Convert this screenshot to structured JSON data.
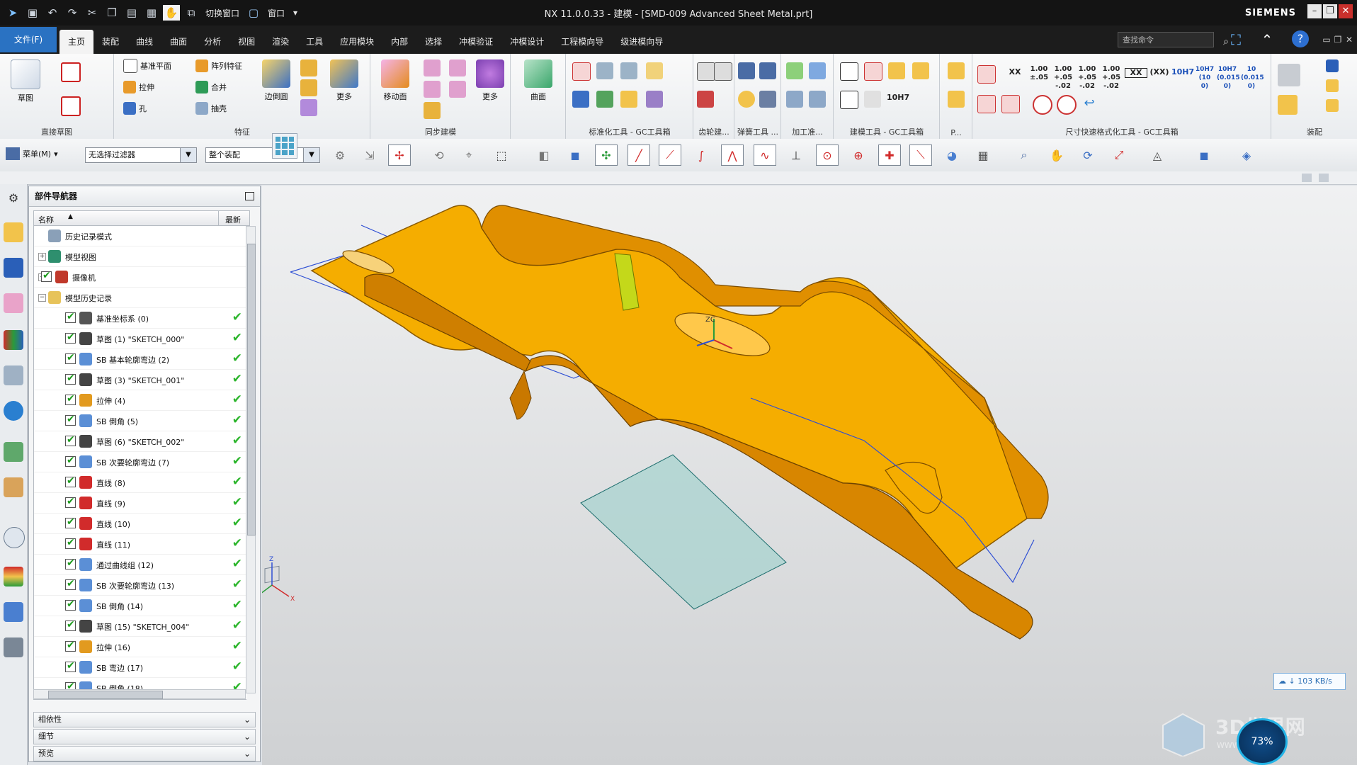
{
  "window": {
    "title": "NX 11.0.0.33 - 建模 - [SMD-009 Advanced Sheet Metal.prt]",
    "brand": "SIEMENS"
  },
  "quick_access": {
    "switch_window": "切换窗口",
    "window": "窗口"
  },
  "menu": {
    "file": "文件(F)",
    "tabs": [
      "主页",
      "装配",
      "曲线",
      "曲面",
      "分析",
      "视图",
      "渲染",
      "工具",
      "应用模块",
      "内部",
      "选择",
      "冲模验证",
      "冲模设计",
      "工程模向导",
      "级进模向导"
    ],
    "search_placeholder": "查找命令"
  },
  "ribbon": {
    "direct_sketch": {
      "sketch": "草图",
      "label": "直接草图"
    },
    "feature": {
      "datum_plane": "基准平面",
      "pattern": "阵列特征",
      "extrude": "拉伸",
      "unite": "合并",
      "hole": "孔",
      "shell": "抽壳",
      "edge_blend": "边倒圆",
      "more": "更多",
      "label": "特征"
    },
    "sync": {
      "move_face": "移动面",
      "more": "更多",
      "label": "同步建模"
    },
    "surface": {
      "label": "曲面"
    },
    "groups": [
      "标准化工具 - GC工具箱",
      "齿轮建...",
      "弹簧工具 ...",
      "加工准...",
      "建模工具 - GC工具箱",
      "P...",
      "尺寸快速格式化工具 - GC工具箱",
      "装配"
    ],
    "dim_tokens": [
      "XX",
      "1.00 ±.05",
      "1.00 +.05 -.02",
      "1.00 +.05 -.02",
      "1.00 +.05 -.02",
      "XX",
      "(XX)",
      "10H7",
      "10H7 (10 0)",
      "10H7 (0.015 0)",
      "10 (0.015 0)"
    ],
    "tool_10h7": "10H7"
  },
  "selection_bar": {
    "menu": "菜单(M)",
    "filter": "无选择过滤器",
    "scope": "整个装配"
  },
  "navigator": {
    "title": "部件导航器",
    "col_name": "名称",
    "col_latest": "最新",
    "rows": [
      {
        "label": "历史记录模式",
        "level": 0,
        "exp": "",
        "check": false,
        "ok": false,
        "icon": "clock-icon",
        "color": "#8aa0b8"
      },
      {
        "label": "模型视图",
        "level": 0,
        "exp": "+",
        "check": false,
        "ok": false,
        "icon": "cube-views-icon",
        "color": "#2e8f6e"
      },
      {
        "label": "摄像机",
        "level": 0,
        "exp": "+",
        "check": true,
        "ok": false,
        "icon": "camera-icon",
        "color": "#c0392b"
      },
      {
        "label": "模型历史记录",
        "level": 0,
        "exp": "−",
        "check": false,
        "ok": false,
        "icon": "folder-icon",
        "color": "#e7c35a"
      },
      {
        "label": "基准坐标系 (0)",
        "level": 1,
        "exp": "",
        "check": true,
        "ok": true,
        "icon": "csys-icon",
        "color": "#555555"
      },
      {
        "label": "草图 (1) \"SKETCH_000\"",
        "level": 1,
        "exp": "",
        "check": true,
        "ok": true,
        "icon": "sketch-icon",
        "color": "#444444"
      },
      {
        "label": "SB 基本轮廓弯边 (2)",
        "level": 1,
        "exp": "",
        "check": true,
        "ok": true,
        "icon": "flange-icon",
        "color": "#5b8fd6"
      },
      {
        "label": "草图 (3) \"SKETCH_001\"",
        "level": 1,
        "exp": "",
        "check": true,
        "ok": true,
        "icon": "sketch-icon",
        "color": "#444444"
      },
      {
        "label": "拉伸 (4)",
        "level": 1,
        "exp": "",
        "check": true,
        "ok": true,
        "icon": "extrude-icon",
        "color": "#e29a1f"
      },
      {
        "label": "SB 倒角 (5)",
        "level": 1,
        "exp": "",
        "check": true,
        "ok": true,
        "icon": "chamfer-icon",
        "color": "#5b8fd6"
      },
      {
        "label": "草图 (6) \"SKETCH_002\"",
        "level": 1,
        "exp": "",
        "check": true,
        "ok": true,
        "icon": "sketch-icon",
        "color": "#444444"
      },
      {
        "label": "SB 次要轮廓弯边 (7)",
        "level": 1,
        "exp": "",
        "check": true,
        "ok": true,
        "icon": "flange-icon",
        "color": "#5b8fd6"
      },
      {
        "label": "直线 (8)",
        "level": 1,
        "exp": "",
        "check": true,
        "ok": true,
        "icon": "line-icon",
        "color": "#d12b2b"
      },
      {
        "label": "直线 (9)",
        "level": 1,
        "exp": "",
        "check": true,
        "ok": true,
        "icon": "line-icon",
        "color": "#d12b2b"
      },
      {
        "label": "直线 (10)",
        "level": 1,
        "exp": "",
        "check": true,
        "ok": true,
        "icon": "line-icon",
        "color": "#d12b2b"
      },
      {
        "label": "直线 (11)",
        "level": 1,
        "exp": "",
        "check": true,
        "ok": true,
        "icon": "line-icon",
        "color": "#d12b2b"
      },
      {
        "label": "通过曲线组 (12)",
        "level": 1,
        "exp": "",
        "check": true,
        "ok": true,
        "icon": "through-curves-icon",
        "color": "#5b8fd6"
      },
      {
        "label": "SB 次要轮廓弯边 (13)",
        "level": 1,
        "exp": "",
        "check": true,
        "ok": true,
        "icon": "flange-icon",
        "color": "#5b8fd6"
      },
      {
        "label": "SB 倒角 (14)",
        "level": 1,
        "exp": "",
        "check": true,
        "ok": true,
        "icon": "chamfer-icon",
        "color": "#5b8fd6"
      },
      {
        "label": "草图 (15) \"SKETCH_004\"",
        "level": 1,
        "exp": "",
        "check": true,
        "ok": true,
        "icon": "sketch-icon",
        "color": "#444444"
      },
      {
        "label": "拉伸 (16)",
        "level": 1,
        "exp": "",
        "check": true,
        "ok": true,
        "icon": "extrude-icon",
        "color": "#e29a1f"
      },
      {
        "label": "SB 弯边 (17)",
        "level": 1,
        "exp": "",
        "check": true,
        "ok": true,
        "icon": "flange-icon",
        "color": "#5b8fd6"
      },
      {
        "label": "SB 倒角 (18)",
        "level": 1,
        "exp": "",
        "check": true,
        "ok": true,
        "icon": "chamfer-icon",
        "color": "#5b8fd6"
      }
    ],
    "panels": [
      "相依性",
      "细节",
      "预览"
    ]
  },
  "viewport": {
    "network_speed": "103 KB/s",
    "progress_percent": "73%",
    "watermark": "3D世界网",
    "watermark_sub": "WWW.3DSJW.COM",
    "part_color": "#f2a900",
    "triad_labels": [
      "Z",
      "X",
      "Y"
    ]
  }
}
